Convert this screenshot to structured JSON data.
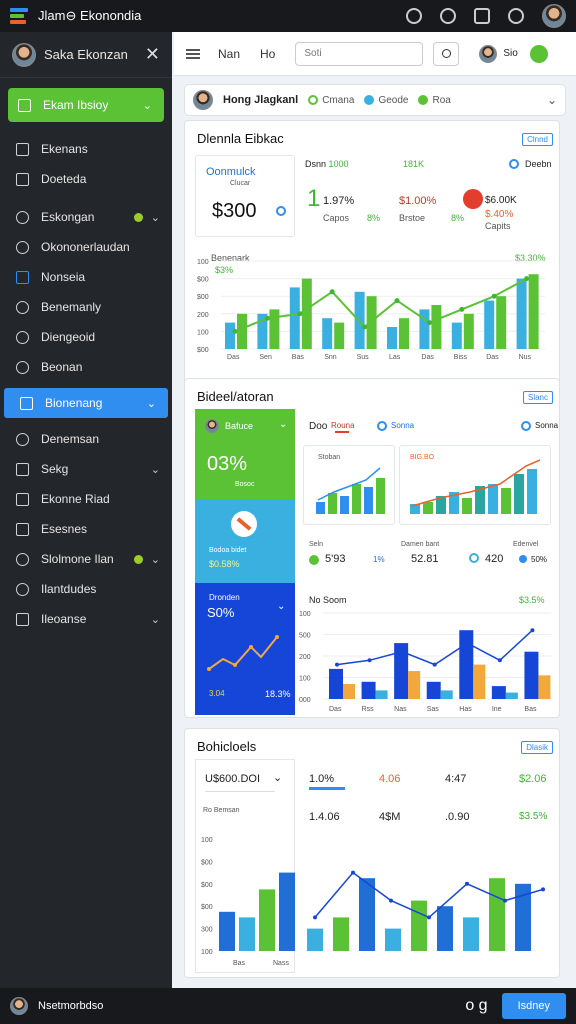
{
  "app": {
    "title": "Jlam⊖ Ekonondia"
  },
  "sidebar": {
    "user_name": "Saka Ekonzan",
    "items": [
      {
        "label": "Ekam Ibsioy",
        "icon": "home-icon",
        "style": "green"
      },
      {
        "label": "Ekenans",
        "icon": "folder-icon"
      },
      {
        "label": "Doeteda",
        "icon": "document-icon"
      },
      {
        "label": "Eskongan",
        "icon": "tools-icon",
        "badge": true
      },
      {
        "label": "Okononerlaudan",
        "icon": "globe-icon"
      },
      {
        "label": "Nonseia",
        "icon": "mail-icon"
      },
      {
        "label": "Benemanly",
        "icon": "chart-icon"
      },
      {
        "label": "Diengeoid",
        "icon": "target-icon"
      },
      {
        "label": "Beonan",
        "icon": "clock-icon"
      },
      {
        "label": "Bionenang",
        "icon": "layers-icon",
        "style": "blue"
      },
      {
        "label": "Denemsan",
        "icon": "user-icon"
      },
      {
        "label": "Sekg",
        "icon": "settings-icon"
      },
      {
        "label": "Ekonne Riad",
        "icon": "list-icon"
      },
      {
        "label": "Esesnes",
        "icon": "grid-icon"
      },
      {
        "label": "Slolmone Ilan",
        "icon": "search-icon",
        "badge": true
      },
      {
        "label": "Ilantdudes",
        "icon": "info-icon"
      },
      {
        "label": "Ileoanse",
        "icon": "bookmark-icon"
      }
    ]
  },
  "header": {
    "link1": "Nan",
    "link2": "Ho",
    "search_placeholder": "Soti",
    "user": "Sio"
  },
  "filterbar": {
    "name": "Hong Jlagkanl",
    "chip1": "Cmana",
    "chip2": "Geode",
    "chip3": "Roa"
  },
  "panel1": {
    "title": "Dlennla Eibkac",
    "button": "Clnnd",
    "card": {
      "title": "Oonmulck",
      "subtitle": "Clucar",
      "value": "$300"
    },
    "stats": [
      {
        "top": "Dsnn",
        "top2": "1000",
        "v": "1",
        "v2": "1.97%",
        "s": "Capos",
        "g": "8%"
      },
      {
        "top": "181K",
        "v": "$1.00%",
        "s": "Brstoe",
        "g": "8%"
      },
      {
        "top": "Deebn",
        "v": "$6.00K",
        "v2": "$.40%",
        "s": "Capits"
      }
    ],
    "chart_ylabels": [
      "100",
      "$00",
      "$00",
      "200",
      "100",
      "$00"
    ],
    "chart_xlabels": [
      "Das",
      "Sen",
      "Bas",
      "Snn",
      "Sus",
      "Las",
      "Das",
      "Biss",
      "Das",
      "Nus"
    ],
    "legend1": "Benenark",
    "legend2": "$3%",
    "end_label": "$3.30%",
    "end_sub": "$3"
  },
  "panel2": {
    "title": "Bideel/atoran",
    "button": "Slanc",
    "green_tile": {
      "title": "Bafuce",
      "value": "03%",
      "sub": "Bosoc"
    },
    "teal_tile": {
      "text": "Bodoa bidet",
      "value": "$0.58%"
    },
    "blue_tile": {
      "title": "Dronden",
      "value": "S0%",
      "a": "3.04",
      "b": "18.3%"
    },
    "tabs": [
      "Doo",
      "Rouna",
      "Sonna"
    ],
    "mini1": {
      "title": "Stoban"
    },
    "mini2": {
      "title": "BIG.BO"
    },
    "stats": [
      {
        "l": "Seln",
        "v": "5'93",
        "p": "1%"
      },
      {
        "l": "Damen bant",
        "v": "52.81",
        "p": ""
      },
      {
        "l": "Edenvel",
        "v": "420",
        "p": "50%"
      }
    ],
    "chart_title": "No Soom",
    "chart_value": "$3.5%",
    "chart_ylabels": [
      "100",
      "500",
      "200",
      "100",
      "000"
    ],
    "chart_xlabels": [
      "Das",
      "Rss",
      "Nas",
      "Sas",
      "Has",
      "Ine",
      "Bas"
    ]
  },
  "panel3": {
    "title": "Bohicloels",
    "button": "Dlasik",
    "stats_row1": [
      "1.0%",
      "4.06",
      "4:47",
      "$2.06"
    ],
    "stats_row2": [
      "1.4.06",
      "4$M",
      ".0.90",
      "$3.5%"
    ],
    "dropdown": "U$600.DOI",
    "chart_label": "Ro Bemsan",
    "chart_ylabels": [
      "100",
      "$00",
      "$00",
      "$00",
      "300",
      "100"
    ],
    "chart_xlabels": [
      "Bas",
      "Nass"
    ]
  },
  "bottom": {
    "label": "Nsetmorbdso",
    "icon": "o g",
    "button": "Isdney"
  },
  "colors": {
    "green": "#5bc236",
    "blue": "#2f8ef0",
    "dark_blue": "#1646d8",
    "teal": "#3ab0e0",
    "sidebar": "#23262b"
  },
  "chart_data": [
    {
      "type": "bar",
      "categories": [
        "Das",
        "Sen",
        "Bas",
        "Snn",
        "Sus",
        "Las",
        "Das",
        "Biss",
        "Das",
        "Nus"
      ],
      "series": [
        {
          "name": "Benenark",
          "values": [
            30,
            40,
            70,
            35,
            65,
            25,
            45,
            30,
            55,
            80
          ]
        },
        {
          "values": [
            40,
            45,
            80,
            30,
            60,
            35,
            50,
            40,
            60,
            85
          ]
        }
      ],
      "line": [
        20,
        35,
        40,
        65,
        25,
        55,
        30,
        45,
        60,
        80
      ]
    },
    {
      "type": "bar",
      "categories": [
        "Das",
        "Rss",
        "Nas",
        "Sas",
        "Has",
        "Ine",
        "Bas"
      ],
      "values": [
        35,
        20,
        65,
        20,
        80,
        15,
        55
      ],
      "line": [
        40,
        45,
        55,
        40,
        65,
        45,
        80
      ]
    },
    {
      "type": "bar",
      "categories": [
        "Bas",
        "Nass"
      ],
      "values": [
        35,
        30,
        55,
        70,
        20,
        30,
        65,
        20,
        45,
        40,
        30,
        65,
        60
      ],
      "line": [
        30,
        70,
        45,
        30,
        60,
        45,
        55
      ]
    }
  ]
}
